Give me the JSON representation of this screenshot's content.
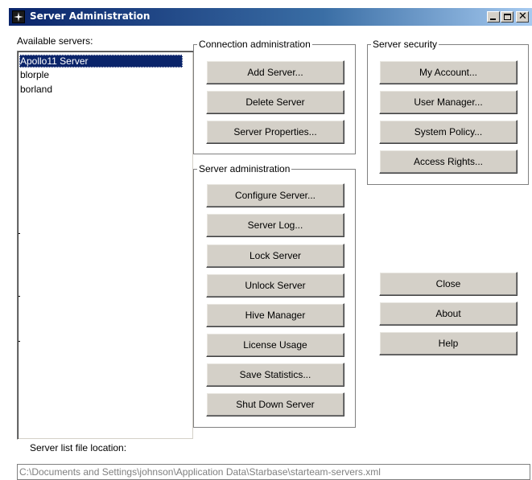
{
  "window": {
    "title": "Server Administration",
    "minimize_label": "_",
    "close_glyph": "✕"
  },
  "servers": {
    "label": "Available servers:",
    "items": [
      {
        "name": "Apollo11 Server",
        "selected": true
      },
      {
        "name": "blorple",
        "selected": false
      },
      {
        "name": "borland",
        "selected": false
      }
    ]
  },
  "connection_admin": {
    "title": "Connection administration",
    "buttons": [
      "Add Server...",
      "Delete Server",
      "Server Properties..."
    ]
  },
  "server_admin": {
    "title": "Server administration",
    "buttons": [
      "Configure Server...",
      "Server Log...",
      "Lock Server",
      "Unlock Server",
      "Hive Manager",
      "License Usage",
      "Save Statistics...",
      "Shut Down Server"
    ]
  },
  "server_security": {
    "title": "Server security",
    "buttons": [
      "My Account...",
      "User Manager...",
      "System Policy...",
      "Access Rights..."
    ]
  },
  "dialog_buttons": [
    "Close",
    "About",
    "Help"
  ],
  "file_location": {
    "label": "Server list file location:",
    "value": "C:\\Documents and Settings\\johnson\\Application Data\\Starbase\\starteam-servers.xml"
  },
  "colors": {
    "title_gradient_start": "#0a246a",
    "selection": "#0a246a",
    "button_face": "#d4d0c8"
  }
}
